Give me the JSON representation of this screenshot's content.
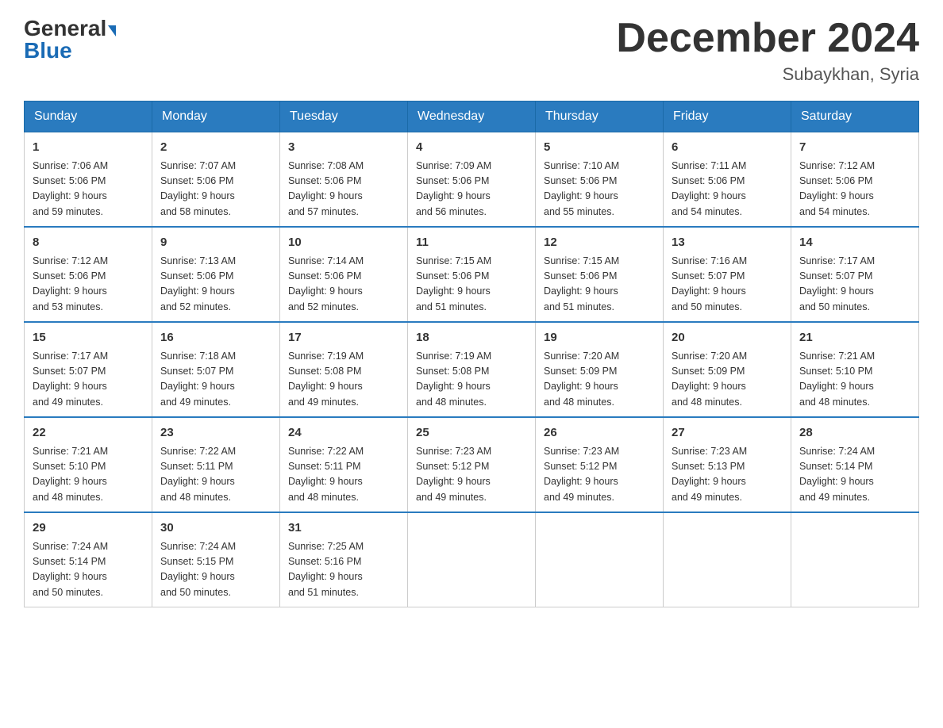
{
  "header": {
    "logo_general": "General",
    "logo_blue": "Blue",
    "month_title": "December 2024",
    "location": "Subaykhan, Syria"
  },
  "days_of_week": [
    "Sunday",
    "Monday",
    "Tuesday",
    "Wednesday",
    "Thursday",
    "Friday",
    "Saturday"
  ],
  "weeks": [
    [
      {
        "day": "1",
        "sunrise": "7:06 AM",
        "sunset": "5:06 PM",
        "daylight": "9 hours and 59 minutes."
      },
      {
        "day": "2",
        "sunrise": "7:07 AM",
        "sunset": "5:06 PM",
        "daylight": "9 hours and 58 minutes."
      },
      {
        "day": "3",
        "sunrise": "7:08 AM",
        "sunset": "5:06 PM",
        "daylight": "9 hours and 57 minutes."
      },
      {
        "day": "4",
        "sunrise": "7:09 AM",
        "sunset": "5:06 PM",
        "daylight": "9 hours and 56 minutes."
      },
      {
        "day": "5",
        "sunrise": "7:10 AM",
        "sunset": "5:06 PM",
        "daylight": "9 hours and 55 minutes."
      },
      {
        "day": "6",
        "sunrise": "7:11 AM",
        "sunset": "5:06 PM",
        "daylight": "9 hours and 54 minutes."
      },
      {
        "day": "7",
        "sunrise": "7:12 AM",
        "sunset": "5:06 PM",
        "daylight": "9 hours and 54 minutes."
      }
    ],
    [
      {
        "day": "8",
        "sunrise": "7:12 AM",
        "sunset": "5:06 PM",
        "daylight": "9 hours and 53 minutes."
      },
      {
        "day": "9",
        "sunrise": "7:13 AM",
        "sunset": "5:06 PM",
        "daylight": "9 hours and 52 minutes."
      },
      {
        "day": "10",
        "sunrise": "7:14 AM",
        "sunset": "5:06 PM",
        "daylight": "9 hours and 52 minutes."
      },
      {
        "day": "11",
        "sunrise": "7:15 AM",
        "sunset": "5:06 PM",
        "daylight": "9 hours and 51 minutes."
      },
      {
        "day": "12",
        "sunrise": "7:15 AM",
        "sunset": "5:06 PM",
        "daylight": "9 hours and 51 minutes."
      },
      {
        "day": "13",
        "sunrise": "7:16 AM",
        "sunset": "5:07 PM",
        "daylight": "9 hours and 50 minutes."
      },
      {
        "day": "14",
        "sunrise": "7:17 AM",
        "sunset": "5:07 PM",
        "daylight": "9 hours and 50 minutes."
      }
    ],
    [
      {
        "day": "15",
        "sunrise": "7:17 AM",
        "sunset": "5:07 PM",
        "daylight": "9 hours and 49 minutes."
      },
      {
        "day": "16",
        "sunrise": "7:18 AM",
        "sunset": "5:07 PM",
        "daylight": "9 hours and 49 minutes."
      },
      {
        "day": "17",
        "sunrise": "7:19 AM",
        "sunset": "5:08 PM",
        "daylight": "9 hours and 49 minutes."
      },
      {
        "day": "18",
        "sunrise": "7:19 AM",
        "sunset": "5:08 PM",
        "daylight": "9 hours and 48 minutes."
      },
      {
        "day": "19",
        "sunrise": "7:20 AM",
        "sunset": "5:09 PM",
        "daylight": "9 hours and 48 minutes."
      },
      {
        "day": "20",
        "sunrise": "7:20 AM",
        "sunset": "5:09 PM",
        "daylight": "9 hours and 48 minutes."
      },
      {
        "day": "21",
        "sunrise": "7:21 AM",
        "sunset": "5:10 PM",
        "daylight": "9 hours and 48 minutes."
      }
    ],
    [
      {
        "day": "22",
        "sunrise": "7:21 AM",
        "sunset": "5:10 PM",
        "daylight": "9 hours and 48 minutes."
      },
      {
        "day": "23",
        "sunrise": "7:22 AM",
        "sunset": "5:11 PM",
        "daylight": "9 hours and 48 minutes."
      },
      {
        "day": "24",
        "sunrise": "7:22 AM",
        "sunset": "5:11 PM",
        "daylight": "9 hours and 48 minutes."
      },
      {
        "day": "25",
        "sunrise": "7:23 AM",
        "sunset": "5:12 PM",
        "daylight": "9 hours and 49 minutes."
      },
      {
        "day": "26",
        "sunrise": "7:23 AM",
        "sunset": "5:12 PM",
        "daylight": "9 hours and 49 minutes."
      },
      {
        "day": "27",
        "sunrise": "7:23 AM",
        "sunset": "5:13 PM",
        "daylight": "9 hours and 49 minutes."
      },
      {
        "day": "28",
        "sunrise": "7:24 AM",
        "sunset": "5:14 PM",
        "daylight": "9 hours and 49 minutes."
      }
    ],
    [
      {
        "day": "29",
        "sunrise": "7:24 AM",
        "sunset": "5:14 PM",
        "daylight": "9 hours and 50 minutes."
      },
      {
        "day": "30",
        "sunrise": "7:24 AM",
        "sunset": "5:15 PM",
        "daylight": "9 hours and 50 minutes."
      },
      {
        "day": "31",
        "sunrise": "7:25 AM",
        "sunset": "5:16 PM",
        "daylight": "9 hours and 51 minutes."
      },
      null,
      null,
      null,
      null
    ]
  ],
  "labels": {
    "sunrise": "Sunrise:",
    "sunset": "Sunset:",
    "daylight": "Daylight:"
  }
}
